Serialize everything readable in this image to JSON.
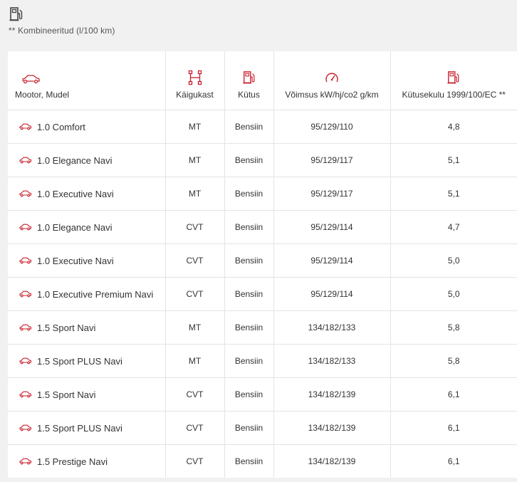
{
  "note": {
    "icon": "fuel-pump-icon",
    "text": "** Kombineeritud (l/100 km)"
  },
  "table": {
    "accent_color": "#c8202d",
    "headers": {
      "model": "Mootor, Mudel",
      "gearbox": "Käigukast",
      "fuel": "Kütus",
      "power": "Võimsus kW/hj/co2 g/km",
      "consumption": "Kütusekulu 1999/100/EC **"
    },
    "header_icons": {
      "model": "car-icon",
      "gearbox": "gearbox-icon",
      "fuel": "fuel-pump-icon",
      "power": "speedometer-icon",
      "consumption": "fuel-pump-icon"
    },
    "rows": [
      {
        "model": "1.0 Comfort",
        "gearbox": "MT",
        "fuel": "Bensiin",
        "power": "95/129/110",
        "consumption": "4,8"
      },
      {
        "model": "1.0 Elegance Navi",
        "gearbox": "MT",
        "fuel": "Bensiin",
        "power": "95/129/117",
        "consumption": "5,1"
      },
      {
        "model": "1.0 Executive Navi",
        "gearbox": "MT",
        "fuel": "Bensiin",
        "power": "95/129/117",
        "consumption": "5,1"
      },
      {
        "model": "1.0 Elegance Navi",
        "gearbox": "CVT",
        "fuel": "Bensiin",
        "power": "95/129/114",
        "consumption": "4,7"
      },
      {
        "model": "1.0 Executive Navi",
        "gearbox": "CVT",
        "fuel": "Bensiin",
        "power": "95/129/114",
        "consumption": "5,0"
      },
      {
        "model": "1.0 Executive Premium Navi",
        "gearbox": "CVT",
        "fuel": "Bensiin",
        "power": "95/129/114",
        "consumption": "5,0"
      },
      {
        "model": "1.5 Sport Navi",
        "gearbox": "MT",
        "fuel": "Bensiin",
        "power": "134/182/133",
        "consumption": "5,8"
      },
      {
        "model": "1.5 Sport PLUS Navi",
        "gearbox": "MT",
        "fuel": "Bensiin",
        "power": "134/182/133",
        "consumption": "5,8"
      },
      {
        "model": "1.5 Sport Navi",
        "gearbox": "CVT",
        "fuel": "Bensiin",
        "power": "134/182/139",
        "consumption": "6,1"
      },
      {
        "model": "1.5 Sport PLUS Navi",
        "gearbox": "CVT",
        "fuel": "Bensiin",
        "power": "134/182/139",
        "consumption": "6,1"
      },
      {
        "model": "1.5 Prestige Navi",
        "gearbox": "CVT",
        "fuel": "Bensiin",
        "power": "134/182/139",
        "consumption": "6,1"
      }
    ]
  }
}
